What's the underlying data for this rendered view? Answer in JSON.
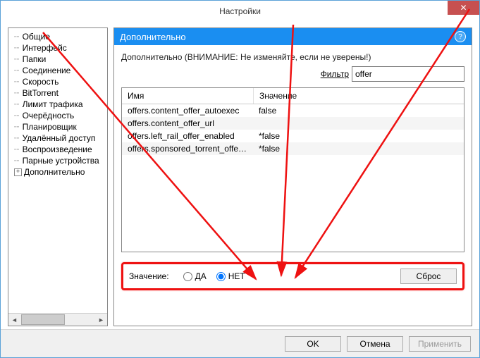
{
  "window": {
    "title": "Настройки",
    "close_glyph": "✕"
  },
  "sidebar": {
    "items": [
      {
        "label": "Общие"
      },
      {
        "label": "Интерфейс"
      },
      {
        "label": "Папки"
      },
      {
        "label": "Соединение"
      },
      {
        "label": "Скорость"
      },
      {
        "label": "BitTorrent"
      },
      {
        "label": "Лимит трафика"
      },
      {
        "label": "Очерёдность"
      },
      {
        "label": "Планировщик"
      },
      {
        "label": "Удалённый доступ"
      },
      {
        "label": "Воспроизведение"
      },
      {
        "label": "Парные устройства"
      },
      {
        "label": "Дополнительно",
        "expandable": true
      }
    ]
  },
  "panel": {
    "heading": "Дополнительно",
    "help_glyph": "?",
    "warning": "Дополнительно (ВНИМАНИЕ: Не изменяйте, если не уверены!)",
    "filter_label": "Фильтр",
    "filter_value": "offer",
    "col_name": "Имя",
    "col_value": "Значение",
    "rows": [
      {
        "name": "offers.content_offer_autoexec",
        "value": "false"
      },
      {
        "name": "offers.content_offer_url",
        "value": ""
      },
      {
        "name": "offers.left_rail_offer_enabled",
        "value": "*false"
      },
      {
        "name": "offers.sponsored_torrent_offer...",
        "value": "*false"
      }
    ],
    "value_label": "Значение:",
    "radio_yes": "ДА",
    "radio_no": "НЕТ",
    "reset_label": "Сброс"
  },
  "footer": {
    "ok": "OK",
    "cancel": "Отмена",
    "apply": "Применить"
  }
}
